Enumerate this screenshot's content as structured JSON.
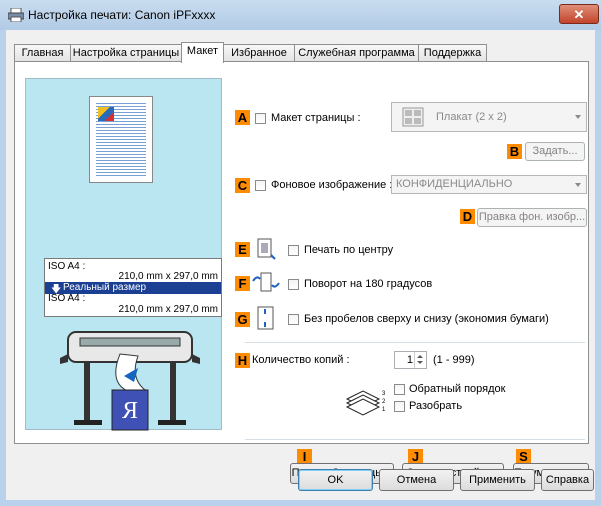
{
  "window": {
    "title": "Настройка печати: Canon iPFxxxx",
    "close_glyph": "✕"
  },
  "tabs": [
    {
      "label": "Главная"
    },
    {
      "label": "Настройка страницы"
    },
    {
      "label": "Макет",
      "active": true
    },
    {
      "label": "Избранное"
    },
    {
      "label": "Служебная программа"
    },
    {
      "label": "Поддержка"
    }
  ],
  "preview": {
    "size_box": {
      "line1": "ISO A4 :",
      "line2": "210,0 mm x 297,0 mm",
      "highlight": "Реальный размер",
      "line4": "ISO A4 :",
      "line5": "210,0 mm x 297,0 mm"
    }
  },
  "layout": {
    "A": {
      "badge": "A",
      "label": "Макет страницы :",
      "combo_value": "Плакат (2 x 2)",
      "combo_icon_text": "4"
    },
    "B": {
      "badge": "B",
      "button": "Задать..."
    },
    "C": {
      "badge": "C",
      "label": "Фоновое изображение :",
      "combo_value": "КОНФИДЕНЦИАЛЬНО"
    },
    "D": {
      "badge": "D",
      "button": "Правка фон. изобр..."
    },
    "E": {
      "badge": "E",
      "label": "Печать по центру"
    },
    "F": {
      "badge": "F",
      "label": "Поворот на 180 градусов"
    },
    "G": {
      "badge": "G",
      "label": "Без пробелов сверху и снизу (экономия бумаги)"
    },
    "H": {
      "badge": "H",
      "label": "Количество копий :",
      "copies_value": "1",
      "range": "(1 - 999)",
      "reverse_label": "Обратный порядок",
      "collate_label": "Разобрать"
    },
    "I": {
      "badge": "I",
      "button": "Парам. Страницы..."
    },
    "J": {
      "badge": "J",
      "button": "Спец. настройки..."
    },
    "S": {
      "badge": "S",
      "button": "По умолчанию"
    }
  },
  "footer": {
    "ok": "OK",
    "cancel": "Отмена",
    "apply": "Применить",
    "help": "Справка"
  },
  "colors": {
    "badge": "#ff8c00",
    "highlight": "#1a3f93",
    "preview_bg": "#b9e6f1"
  }
}
